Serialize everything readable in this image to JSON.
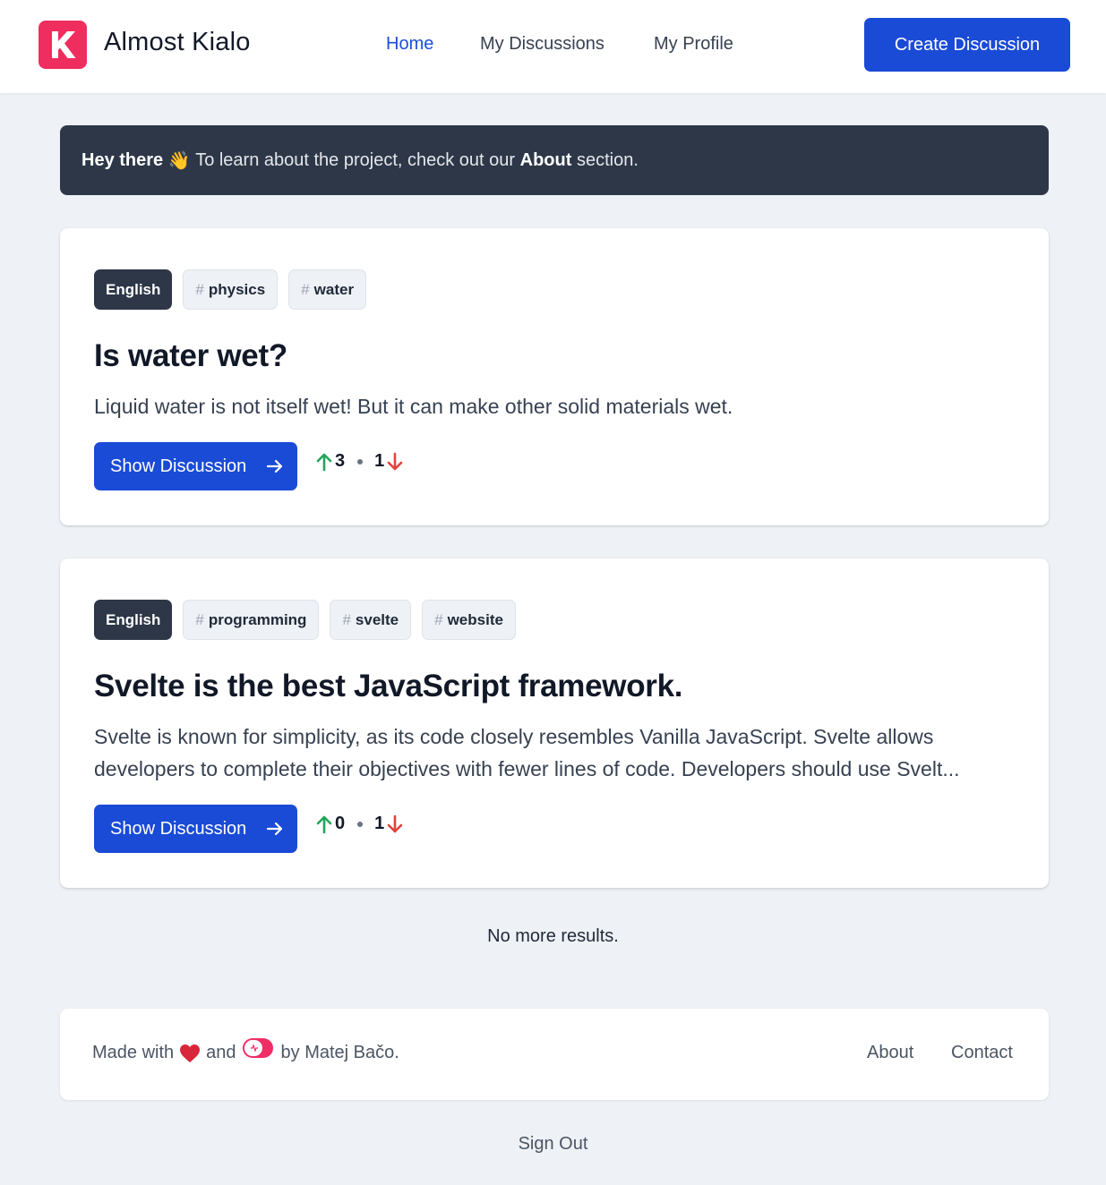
{
  "header": {
    "brand_logo_letter": "K",
    "brand_name": "Almost Kialo",
    "nav": [
      {
        "label": "Home",
        "active": true
      },
      {
        "label": "My Discussions",
        "active": false
      },
      {
        "label": "My Profile",
        "active": false
      }
    ],
    "create_button_label": "Create Discussion",
    "brand_color": "#ef2d5e",
    "accent_color": "#1a4bd6"
  },
  "banner": {
    "greeting": "Hey there",
    "emoji": "👋",
    "text_before": "To learn about the project, check out our",
    "link_text": "About",
    "text_after": "section."
  },
  "discussions": [
    {
      "language": "English",
      "tags": [
        "physics",
        "water"
      ],
      "title": "Is water wet?",
      "description": "Liquid water is not itself wet! But it can make other solid materials wet.",
      "button_label": "Show Discussion",
      "upvotes": "3",
      "downvotes": "1"
    },
    {
      "language": "English",
      "tags": [
        "programming",
        "svelte",
        "website"
      ],
      "title": "Svelte is the best JavaScript framework.",
      "description": "Svelte is known for simplicity, as its code closely resembles Vanilla JavaScript. Svelte allows developers to complete their objectives with fewer lines of code. Developers should use Svelt...",
      "button_label": "Show Discussion",
      "upvotes": "0",
      "downvotes": "1"
    }
  ],
  "tag_hash": "#",
  "no_more_results": "No more results.",
  "footer": {
    "made_with": "Made with",
    "and": "and",
    "by": "by Matej Bačo.",
    "icons": [
      "heart-icon",
      "appwrite-logo-icon"
    ],
    "links": [
      "About",
      "Contact"
    ]
  },
  "sign_out_label": "Sign Out",
  "colors": {
    "upvote": "#22a55a",
    "downvote": "#e0443e",
    "banner_bg": "#2d3748",
    "page_bg": "#eef1f6"
  }
}
